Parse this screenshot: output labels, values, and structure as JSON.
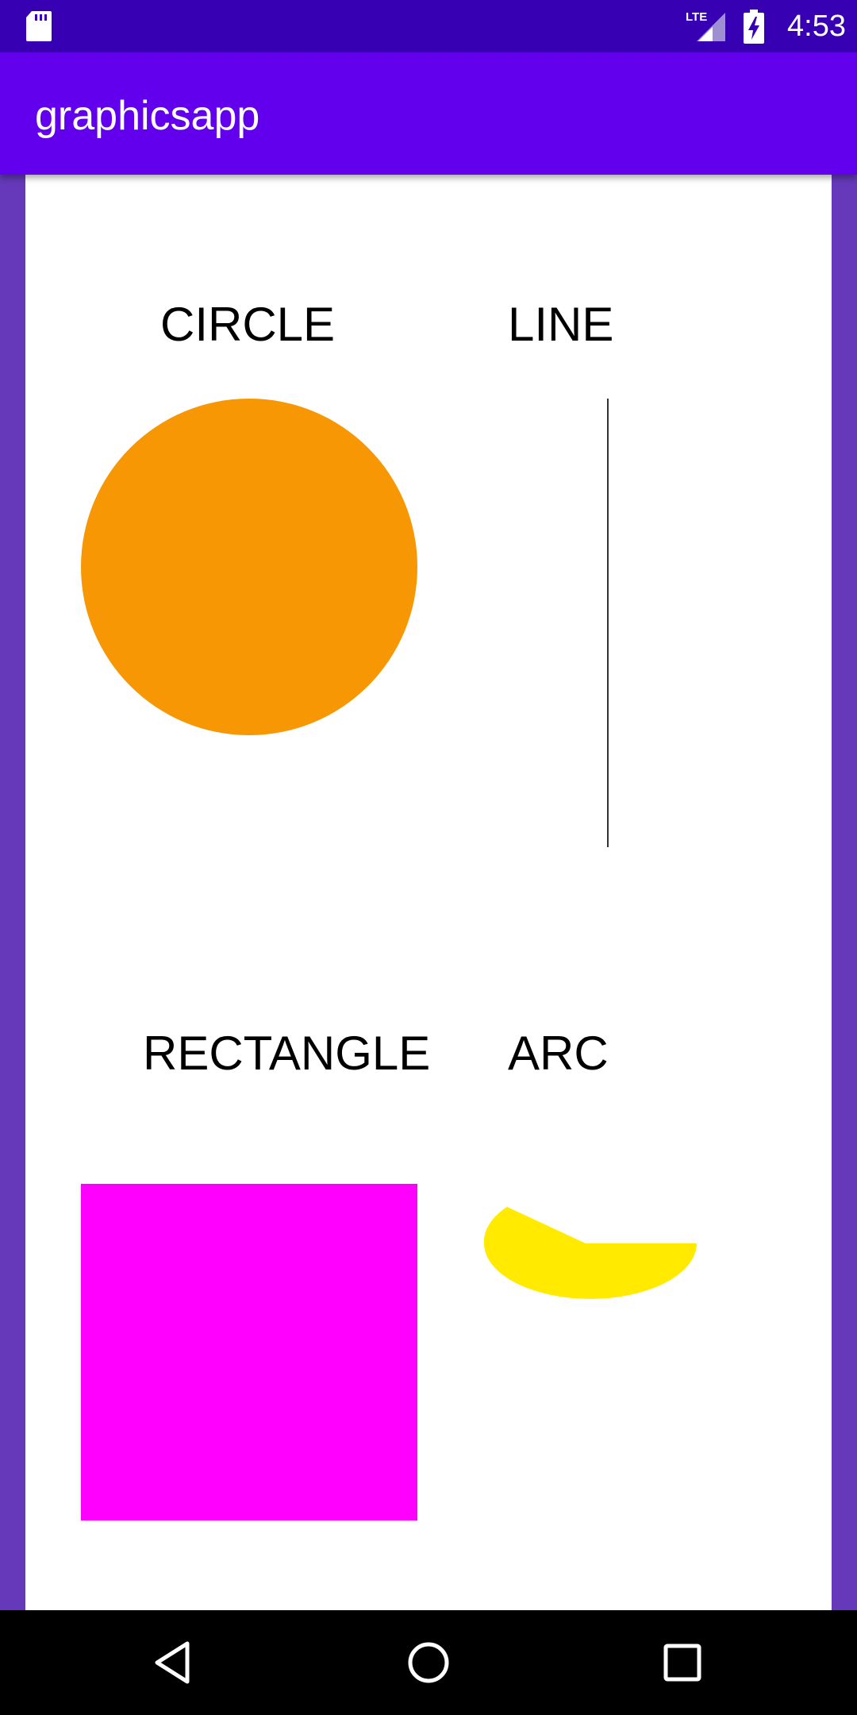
{
  "status_bar": {
    "time": "4:53",
    "network": "LTE",
    "icons": [
      "sd-card-icon",
      "lte-signal-icon",
      "battery-charging-icon"
    ]
  },
  "app_bar": {
    "title": "graphicsapp"
  },
  "canvas": {
    "labels": {
      "circle": "CIRCLE",
      "line": "LINE",
      "rectangle": "RECTANGLE",
      "arc": "ARC"
    },
    "colors": {
      "circle": "#f89704",
      "line": "#333333",
      "rectangle": "#ff00ff",
      "arc": "#ffea00"
    }
  },
  "nav_bar": {
    "icons": [
      "back-icon",
      "home-icon",
      "recents-icon"
    ]
  },
  "theme": {
    "status_bar": "#3700b3",
    "app_bar": "#6200ee",
    "window_background": "#6539b9"
  }
}
